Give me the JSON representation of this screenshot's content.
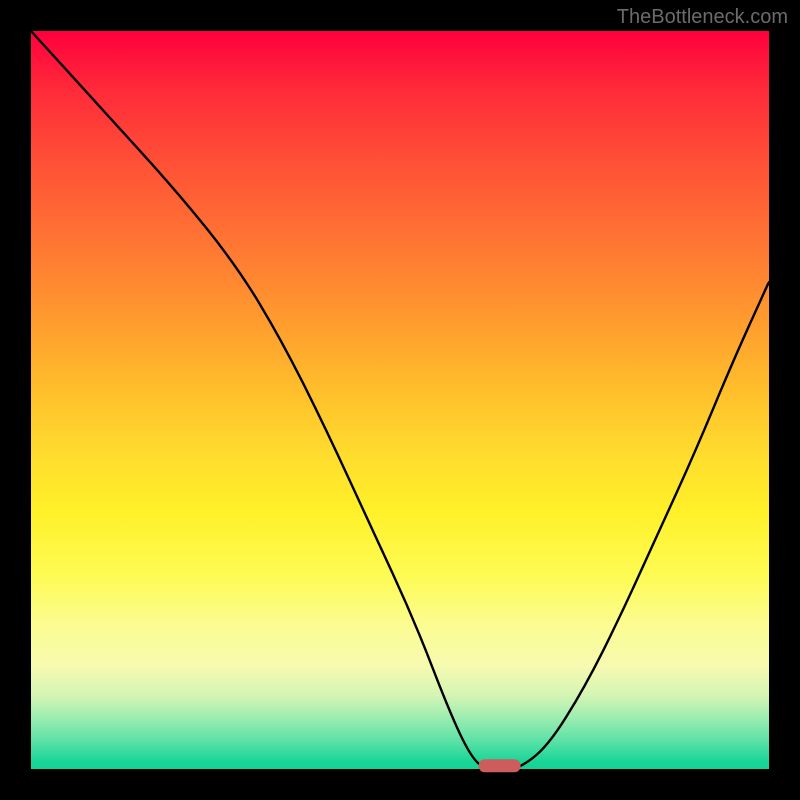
{
  "attribution": "TheBottleneck.com",
  "chart_data": {
    "type": "line",
    "title": "",
    "xlabel": "",
    "ylabel": "",
    "xlim": [
      0,
      100
    ],
    "ylim": [
      0,
      100
    ],
    "series": [
      {
        "name": "bottleneck-curve",
        "x": [
          0,
          10,
          20,
          28,
          34,
          40,
          46,
          52,
          57,
          60,
          62,
          64,
          66,
          70,
          75,
          80,
          85,
          90,
          95,
          100
        ],
        "values": [
          100,
          89,
          78,
          68,
          58,
          46,
          33,
          20,
          7,
          1,
          0,
          0,
          0,
          3,
          11,
          21,
          32,
          43,
          55,
          66
        ]
      }
    ],
    "marker": {
      "x": 63.5,
      "y": 0.5,
      "label": "optimal-point"
    },
    "gradient_stops": [
      {
        "pos": 0,
        "color": "#ff003c"
      },
      {
        "pos": 50,
        "color": "#ffc32c"
      },
      {
        "pos": 80,
        "color": "#fcfc8e"
      },
      {
        "pos": 100,
        "color": "#14d294"
      }
    ]
  }
}
